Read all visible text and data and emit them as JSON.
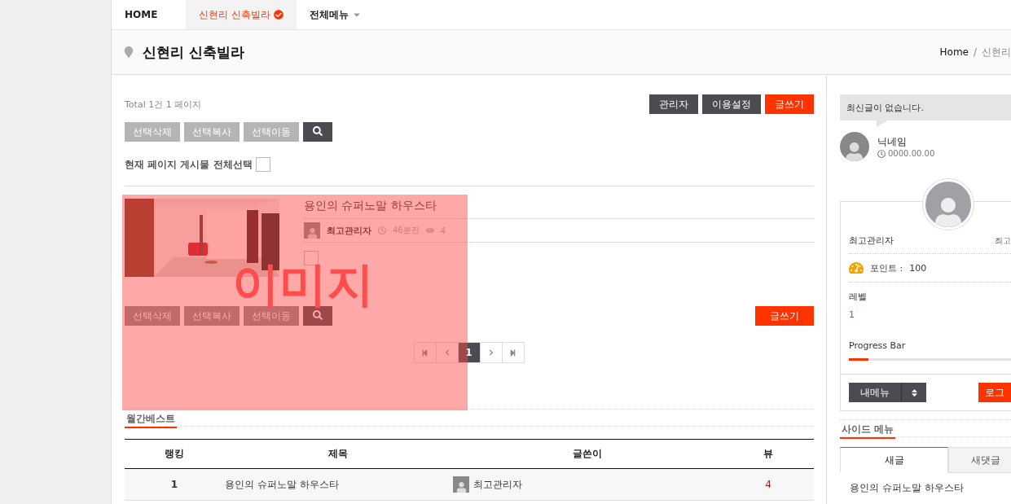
{
  "nav": {
    "items": [
      {
        "label": "HOME",
        "selected": false,
        "kind": "link"
      },
      {
        "label": "신현리 신축빌라",
        "selected": true,
        "kind": "check"
      },
      {
        "label": "전체메뉴",
        "selected": false,
        "kind": "dropdown"
      }
    ]
  },
  "header": {
    "title": "신현리 신축빌라",
    "breadcrumb": [
      "Home",
      "신현리"
    ],
    "breadcrumb_separator": "/"
  },
  "board": {
    "total": "Total 1건 1 페이지",
    "admin_buttons": [
      {
        "label": "관리자",
        "kind": "dark"
      },
      {
        "label": "이용설정",
        "kind": "dark"
      },
      {
        "label": "글쓰기",
        "kind": "primary"
      }
    ],
    "select_buttons": [
      "선택삭제",
      "선택복사",
      "선택이동"
    ],
    "select_all": {
      "label": "현재 페이지 게시물 전체선택",
      "checked": false
    },
    "posts": [
      {
        "title": "용인의 슈퍼노말 하우스타",
        "author": "최고관리자",
        "time": "46분전",
        "views": "4",
        "checked": false,
        "kind": "picture"
      }
    ],
    "bottom_select_buttons": [
      "선택삭제",
      "선택복사",
      "선택이동"
    ],
    "bottom_write": "글쓰기",
    "pagination": {
      "pages": [
        {
          "label": "1",
          "selected": true
        }
      ]
    }
  },
  "monthly_best": {
    "title": "월간베스트",
    "columns": [
      "랭킹",
      "제목",
      "글쓴이",
      "뷰"
    ],
    "rows": [
      {
        "rank": "1",
        "title": "용인의 슈퍼노말 하우스타",
        "author": "최고관리자",
        "views": "4"
      }
    ]
  },
  "overlay": {
    "label": "이미지"
  },
  "sidebar": {
    "notice": "최신글이 없습니다.",
    "latest_user": {
      "name": "닉네임",
      "date": "0000.00.00"
    },
    "profile": {
      "name": "최고관리자",
      "grade": "최고",
      "points_label": "포인트 :",
      "points": "100",
      "level_label": "레벨",
      "level_value": "1",
      "progress_label": "Progress Bar",
      "level": 0.12
    },
    "menu_button": "내메뉴",
    "logout_button": "로그",
    "side_menu_title": "사이드 메뉴",
    "tabs": [
      {
        "label": "새글",
        "selected": true
      },
      {
        "label": "새댓글",
        "selected": false
      }
    ],
    "latest_posts": [
      "용인의 슈퍼노말 하우스타"
    ]
  }
}
